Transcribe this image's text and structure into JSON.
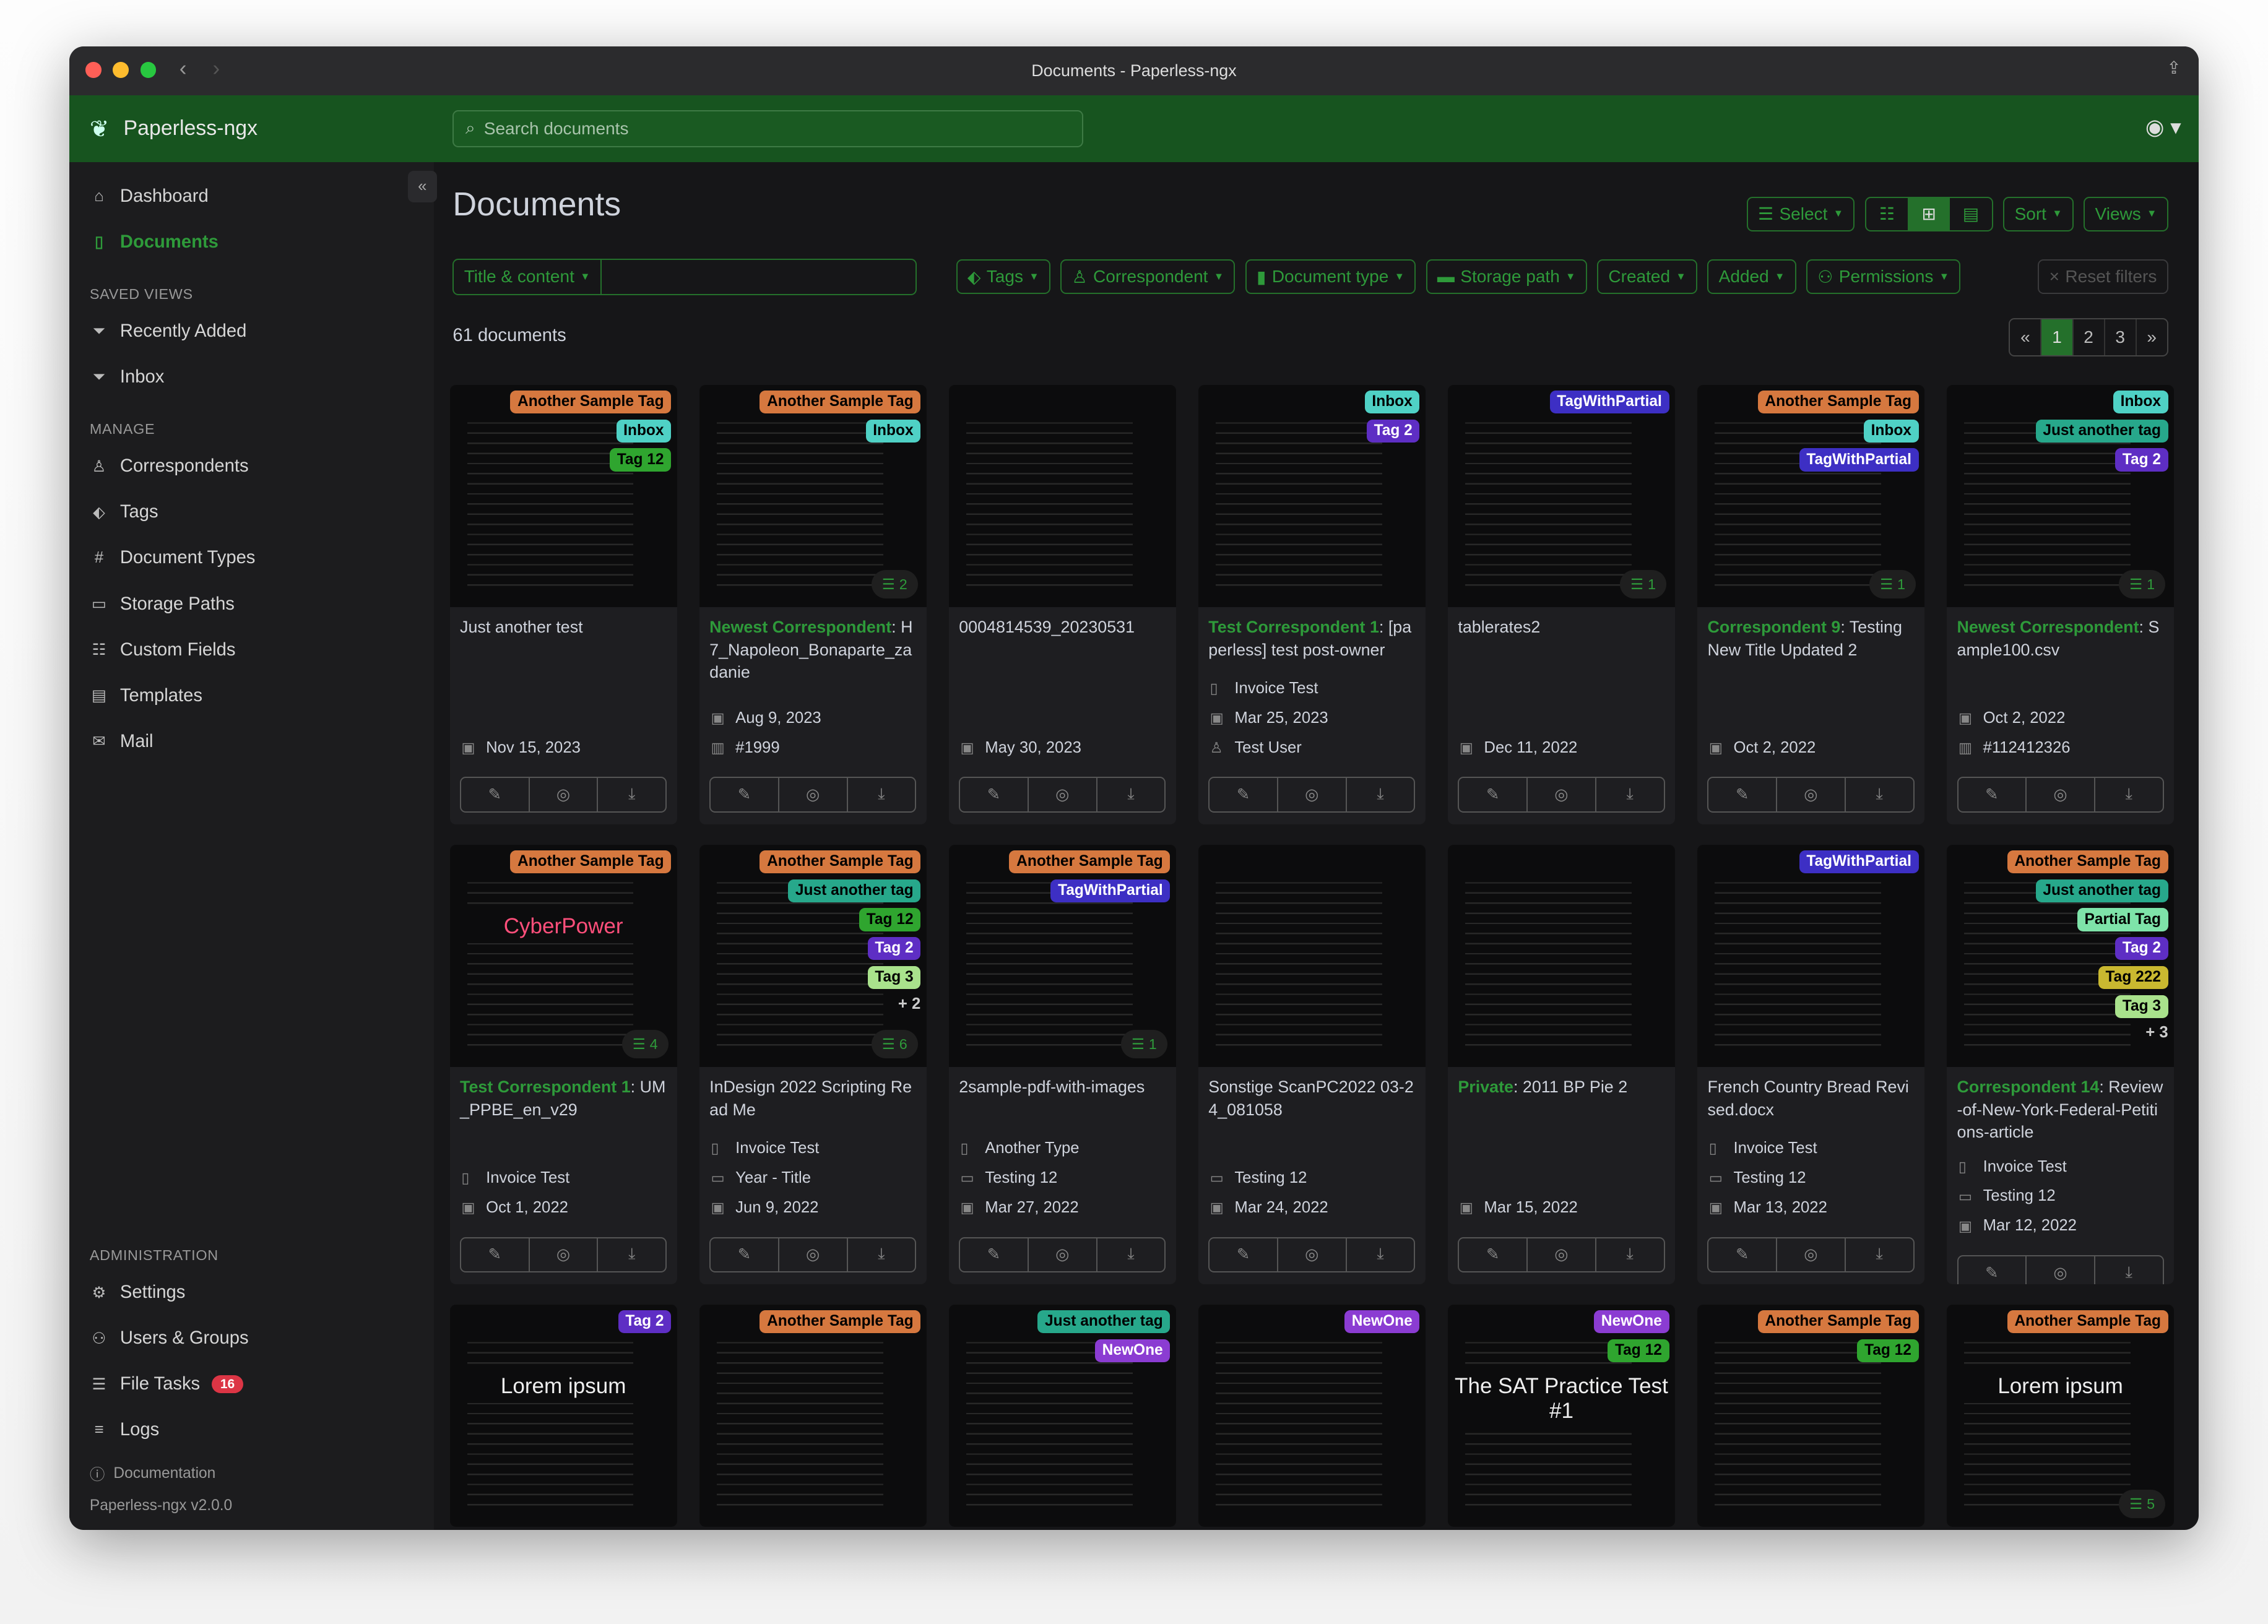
{
  "window": {
    "title": "Documents - Paperless-ngx"
  },
  "header": {
    "brand": "Paperless-ngx",
    "search_placeholder": "Search documents"
  },
  "sidebar": {
    "main": [
      {
        "label": "Dashboard",
        "icon": "home-icon"
      },
      {
        "label": "Documents",
        "icon": "documents-icon",
        "active": true
      }
    ],
    "saved_views_heading": "SAVED VIEWS",
    "saved_views": [
      {
        "label": "Recently Added",
        "icon": "funnel-icon"
      },
      {
        "label": "Inbox",
        "icon": "funnel-icon"
      }
    ],
    "manage_heading": "MANAGE",
    "manage": [
      {
        "label": "Correspondents",
        "icon": "person-icon"
      },
      {
        "label": "Tags",
        "icon": "tag-icon"
      },
      {
        "label": "Document Types",
        "icon": "hash-icon"
      },
      {
        "label": "Storage Paths",
        "icon": "folder-icon"
      },
      {
        "label": "Custom Fields",
        "icon": "ui-radios-icon"
      },
      {
        "label": "Templates",
        "icon": "file-text-icon"
      },
      {
        "label": "Mail",
        "icon": "envelope-icon"
      }
    ],
    "admin_heading": "ADMINISTRATION",
    "admin": [
      {
        "label": "Settings",
        "icon": "gear-icon"
      },
      {
        "label": "Users & Groups",
        "icon": "people-icon"
      },
      {
        "label": "File Tasks",
        "icon": "list-task-icon",
        "badge": "16"
      },
      {
        "label": "Logs",
        "icon": "text-list-icon"
      }
    ],
    "documentation": "Documentation",
    "version": "Paperless-ngx v2.0.0"
  },
  "page": {
    "title": "Documents",
    "select_label": "Select",
    "sort_label": "Sort",
    "views_label": "Views",
    "title_content_label": "Title & content",
    "filters": [
      "Tags",
      "Correspondent",
      "Document type",
      "Storage path",
      "Created",
      "Added",
      "Permissions"
    ],
    "reset_label": "Reset filters",
    "count": "61 documents",
    "pagination": [
      "«",
      "1",
      "2",
      "3",
      "»"
    ],
    "current_page": "1"
  },
  "tag_colors": {
    "Another Sample Tag": [
      "#d6783f",
      "#000"
    ],
    "Inbox": [
      "#4fd1c5",
      "#000"
    ],
    "Tag 12": [
      "#2fa52f",
      "#000"
    ],
    "Tag 2": [
      "#5e2ec4",
      "#fff"
    ],
    "TagWithPartial": [
      "#3d2fc4",
      "#fff"
    ],
    "Just another tag": [
      "#27a88b",
      "#000"
    ],
    "Partial Tag": [
      "#7ee3a9",
      "#000"
    ],
    "Tag 222": [
      "#c9b830",
      "#000"
    ],
    "Tag 3": [
      "#a9e28c",
      "#000"
    ],
    "NewOne": [
      "#8b3cd2",
      "#fff"
    ]
  },
  "documents": [
    {
      "title": "Just another test",
      "tags": [
        "Another Sample Tag",
        "Inbox",
        "Tag 12"
      ],
      "date": "Nov 15, 2023"
    },
    {
      "correspondent": "Newest Correspondent",
      "title": "H7_Napoleon_Bonaparte_zadanie",
      "tags": [
        "Another Sample Tag",
        "Inbox"
      ],
      "notes": "2",
      "date": "Aug 9, 2023",
      "asn": "#1999"
    },
    {
      "title": "0004814539_20230531",
      "tags": [],
      "date": "May 30, 2023"
    },
    {
      "correspondent": "Test Correspondent 1",
      "title": "[paperless] test post-owner",
      "tags": [
        "Inbox",
        "Tag 2"
      ],
      "doc_type": "Invoice Test",
      "date": "Mar 25, 2023",
      "owner": "Test User"
    },
    {
      "title": "tablerates2",
      "tags": [
        "TagWithPartial"
      ],
      "notes": "1",
      "date": "Dec 11, 2022"
    },
    {
      "correspondent": "Correspondent 9",
      "title": "Testing New Title Updated 2",
      "tags": [
        "Another Sample Tag",
        "Inbox",
        "TagWithPartial"
      ],
      "notes": "1",
      "date": "Oct 2, 2022"
    },
    {
      "correspondent": "Newest Correspondent",
      "title": "Sample100.csv",
      "tags": [
        "Inbox",
        "Just another tag",
        "Tag 2"
      ],
      "notes": "1",
      "date": "Oct 2, 2022",
      "asn": "#112412326"
    },
    {
      "correspondent": "Test Correspondent 1",
      "title": "UM_PPBE_en_v29",
      "tags": [
        "Another Sample Tag"
      ],
      "notes": "4",
      "doc_type": "Invoice Test",
      "date": "Oct 1, 2022",
      "preview_text": "CyberPower"
    },
    {
      "title": "InDesign 2022 Scripting Read Me",
      "tags": [
        "Another Sample Tag",
        "Just another tag",
        "Tag 12",
        "Tag 2",
        "Tag 3"
      ],
      "more_tags": "+ 2",
      "notes": "6",
      "doc_type": "Invoice Test",
      "storage_path": "Year - Title",
      "date": "Jun 9, 2022"
    },
    {
      "title": "2sample-pdf-with-images",
      "tags": [
        "Another Sample Tag",
        "TagWithPartial"
      ],
      "notes": "1",
      "doc_type": "Another Type",
      "storage_path": "Testing 12",
      "date": "Mar 27, 2022"
    },
    {
      "title": "Sonstige ScanPC2022 03-24_081058",
      "tags": [],
      "storage_path": "Testing 12",
      "date": "Mar 24, 2022"
    },
    {
      "correspondent": "Private",
      "title": "2011 BP Pie 2",
      "tags": [],
      "date": "Mar 15, 2022"
    },
    {
      "title": "French Country Bread Revised.docx",
      "tags": [
        "TagWithPartial"
      ],
      "doc_type": "Invoice Test",
      "storage_path": "Testing 12",
      "date": "Mar 13, 2022"
    },
    {
      "correspondent": "Correspondent 14",
      "title": "Review-of-New-York-Federal-Petitions-article",
      "tags": [
        "Another Sample Tag",
        "Just another tag",
        "Partial Tag",
        "Tag 2",
        "Tag 222",
        "Tag 3"
      ],
      "more_tags": "+ 3",
      "doc_type": "Invoice Test",
      "storage_path": "Testing 12",
      "date": "Mar 12, 2022"
    },
    {
      "tags": [
        "Tag 2"
      ],
      "preview_text": "Lorem ipsum"
    },
    {
      "tags": [
        "Another Sample Tag"
      ]
    },
    {
      "tags": [
        "Just another tag",
        "NewOne"
      ]
    },
    {
      "tags": [
        "NewOne"
      ]
    },
    {
      "tags": [
        "NewOne",
        "Tag 12"
      ],
      "preview_text": "The SAT Practice Test #1"
    },
    {
      "tags": [
        "Another Sample Tag",
        "Tag 12"
      ]
    },
    {
      "tags": [
        "Another Sample Tag"
      ],
      "notes": "5",
      "preview_text": "Lorem ipsum"
    }
  ]
}
